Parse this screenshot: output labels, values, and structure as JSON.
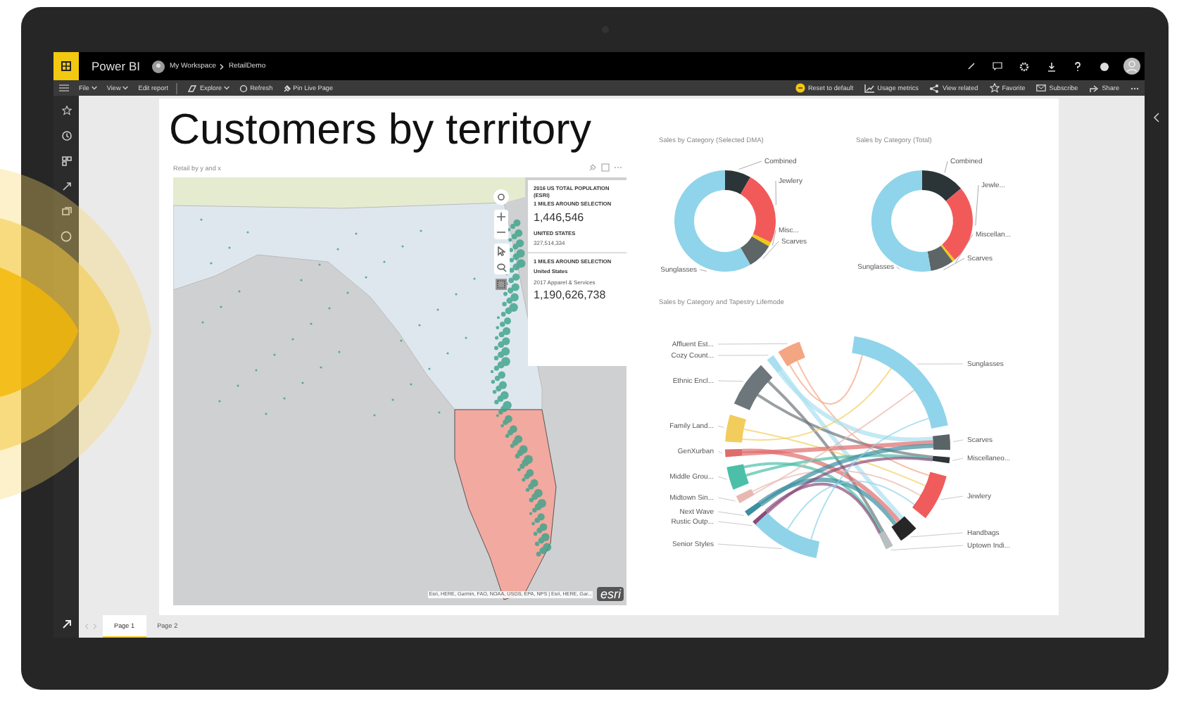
{
  "app_bar": {
    "title": "Power BI",
    "breadcrumb": [
      "My Workspace",
      "RetailDemo"
    ]
  },
  "toolbar_left": [
    {
      "label": "File",
      "kind": "menu"
    },
    {
      "label": "View",
      "kind": "menu"
    },
    {
      "label": "Edit report",
      "kind": "button"
    },
    {
      "label": "Explore",
      "kind": "menu"
    },
    {
      "label": "Refresh",
      "kind": "button"
    },
    {
      "label": "Pin Live Page",
      "kind": "button"
    }
  ],
  "toolbar_right": [
    "Reset to default",
    "Usage metrics",
    "View related",
    "Favorite",
    "Subscribe",
    "Share"
  ],
  "report": {
    "title": "Customers by territory",
    "map": {
      "header": "Retail by y and x",
      "infobox": [
        {
          "kind": "caption",
          "text": "2016 US TOTAL POPULATION (ESRI)"
        },
        {
          "kind": "caption",
          "text": "1 MILES AROUND SELECTION"
        },
        {
          "kind": "value",
          "text": "1,446,546"
        },
        {
          "kind": "caption",
          "text": "UNITED STATES"
        },
        {
          "kind": "small",
          "text": "327,514,334"
        },
        {
          "kind": "divider"
        },
        {
          "kind": "caption",
          "text": "1 MILES AROUND SELECTION"
        },
        {
          "kind": "caption",
          "text": "United States"
        },
        {
          "kind": "small",
          "text": "2017 Apparel & Services"
        },
        {
          "kind": "value",
          "text": "1,190,626,738"
        }
      ],
      "attribution": "Esri, HERE, Garmin, FAO, NOAA, USGS, EPA, NPS | Esri, HERE, Gar...",
      "logo": "esri"
    },
    "donuts": [
      {
        "title": "Sales by Category (Selected DMA)",
        "segments": [
          {
            "label": "Combined",
            "color": "#2b3538"
          },
          {
            "label": "Jewlery",
            "color": "#f25a5a"
          },
          {
            "label": "Misc...",
            "color": "#f2c811"
          },
          {
            "label": "Scarves",
            "color": "#5d6567"
          },
          {
            "label": "Sunglasses",
            "color": "#8fd4ea"
          }
        ]
      },
      {
        "title": "Sales by Category (Total)",
        "segments": [
          {
            "label": "Combined",
            "color": "#2b3538"
          },
          {
            "label": "Jewle...",
            "color": "#f25a5a"
          },
          {
            "label": "Miscellan...",
            "color": "#f2c811"
          },
          {
            "label": "Scarves",
            "color": "#5d6567"
          },
          {
            "label": "Sunglasses",
            "color": "#8fd4ea"
          }
        ]
      }
    ],
    "chord": {
      "title": "Sales by Category and Tapestry Lifemode",
      "left": [
        {
          "label": "Affluent Est...",
          "color": "#f4a582"
        },
        {
          "label": "Cozy Count...",
          "color": "#a9dff0"
        },
        {
          "label": "Ethnic Encl...",
          "color": "#6d767a"
        },
        {
          "label": "Family Land...",
          "color": "#f2cd5c"
        },
        {
          "label": "GenXurban",
          "color": "#e06b6b"
        },
        {
          "label": "Middle Grou...",
          "color": "#4bbfa8"
        },
        {
          "label": "Midtown Sin...",
          "color": "#e8b8b0"
        },
        {
          "label": "Next Wave",
          "color": "#3a8fa0"
        },
        {
          "label": "Rustic Outp...",
          "color": "#8a4a7a"
        },
        {
          "label": "Senior Styles",
          "color": "#8fd3e9"
        }
      ],
      "right": [
        {
          "label": "Sunglasses",
          "color": "#8fd4ea"
        },
        {
          "label": "Scarves",
          "color": "#5a6466"
        },
        {
          "label": "Miscellaneo...",
          "color": "#2f3538"
        },
        {
          "label": "Jewlery",
          "color": "#f05b5b"
        },
        {
          "label": "Handbags",
          "color": "#262626"
        },
        {
          "label": "Uptown Indi...",
          "color": "#b9bec0"
        }
      ]
    }
  },
  "pages": [
    {
      "label": "Page 1",
      "selected": true
    },
    {
      "label": "Page 2",
      "selected": false
    }
  ]
}
